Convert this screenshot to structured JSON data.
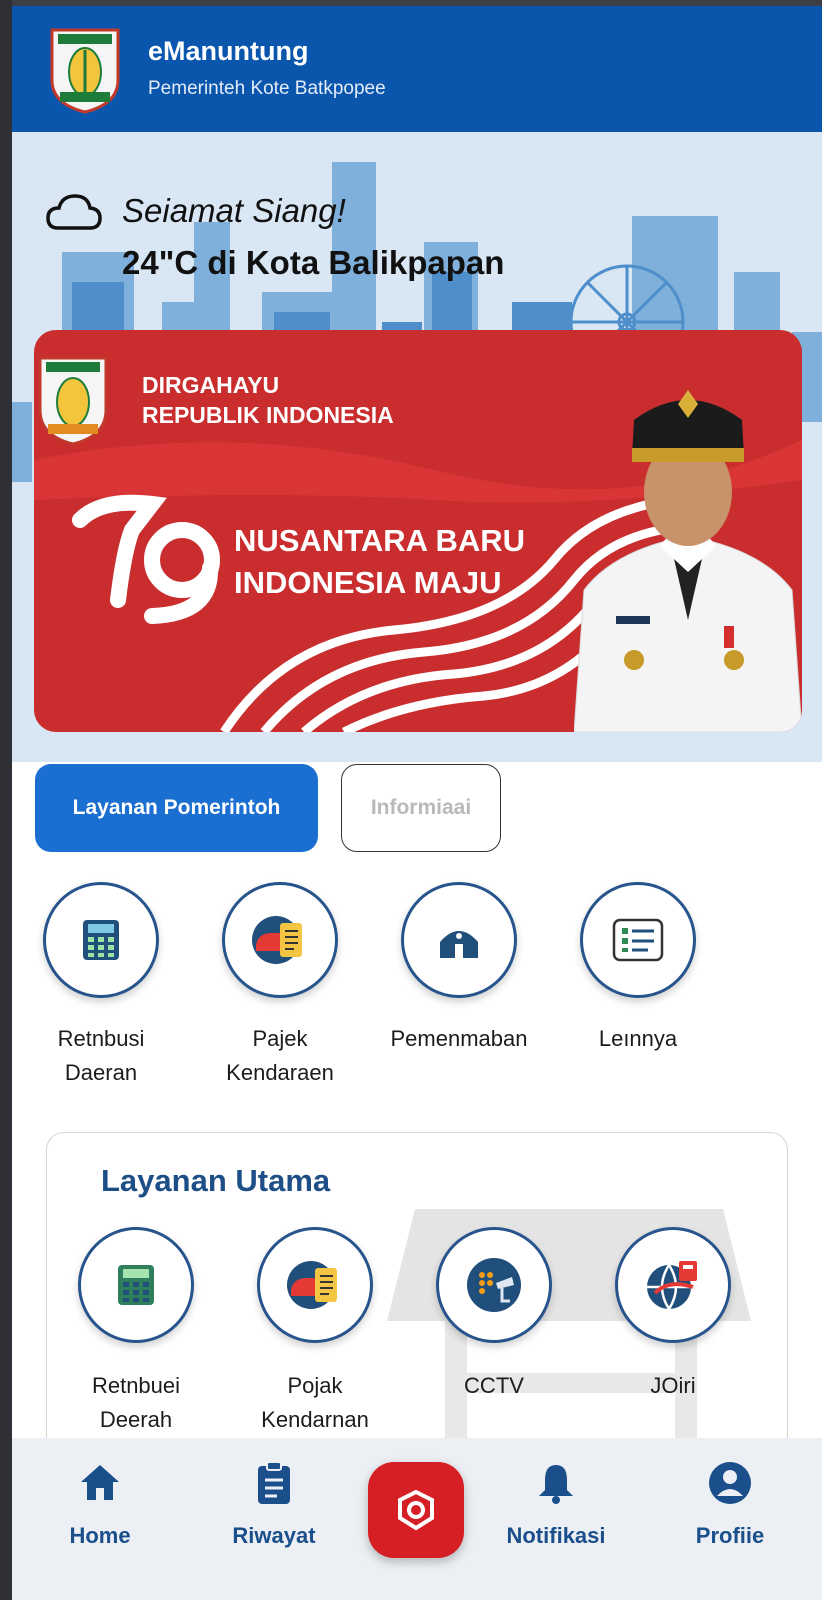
{
  "header": {
    "app_title": "eManuntung",
    "subtitle": "Pemerinteh Kote Batkpopee"
  },
  "hero": {
    "greeting": "Seiamat Siang!",
    "weather": "24\"C di Kota Balikpapan",
    "weather_icon": "cloud-icon",
    "banner": {
      "line1": "DIRGAHAYU",
      "line2": "REPUBLIK INDONESIA",
      "slogan1": "NUSANTARA BARU",
      "slogan2": "INDONESIA MAJU"
    }
  },
  "tabs": {
    "primary": "Layanan Pomerintoh",
    "secondary": "Informiaai"
  },
  "services": [
    {
      "line1": "Retnbusi",
      "line2": "Daeran",
      "icon": "calculator-icon"
    },
    {
      "line1": "Pajek",
      "line2": "Kendaraen",
      "icon": "vehicle-tax-icon"
    },
    {
      "line1": "Pemenmaban",
      "line2": "",
      "icon": "house-icon"
    },
    {
      "line1": "Leınnya",
      "line2": "",
      "icon": "more-icon"
    }
  ],
  "main_card": {
    "title": "Layanan Utama",
    "items": [
      {
        "line1": "Retnbuei",
        "line2": "Deerah",
        "icon": "calculator-icon"
      },
      {
        "line1": "Pojak",
        "line2": "Kendarnan",
        "icon": "vehicle-tax-icon"
      },
      {
        "line1": "CCTV",
        "line2": "",
        "icon": "cctv-icon"
      },
      {
        "line1": "JOiri",
        "line2": "",
        "icon": "globe-icon"
      }
    ]
  },
  "bottom_nav": {
    "home": "Home",
    "history": "Riwayat",
    "notifications": "Notifikasi",
    "profile": "Profiie"
  },
  "colors": {
    "primary_blue": "#0a56ad",
    "tab_blue": "#1b6fd0",
    "title_blue": "#1d4e86",
    "banner_red": "#c92d2e",
    "fab_red": "#d61f25"
  }
}
